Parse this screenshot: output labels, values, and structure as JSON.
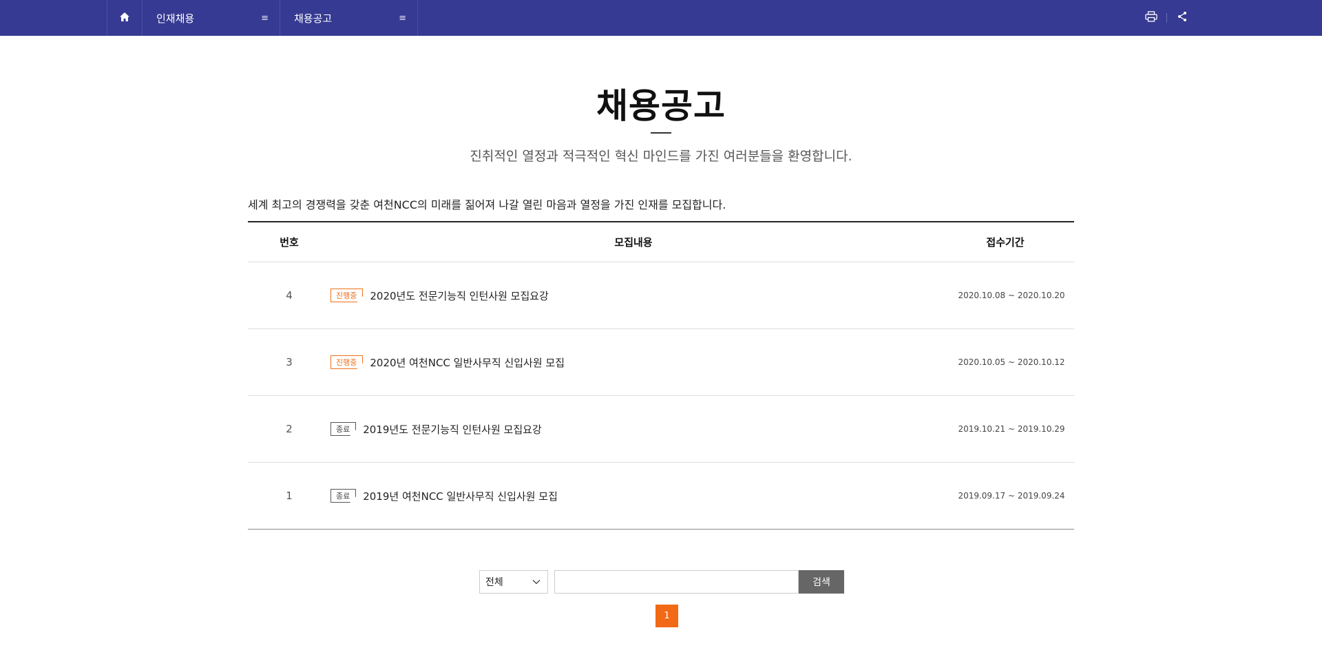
{
  "nav": {
    "home_icon": "home-icon",
    "menu1_label": "인재채용",
    "menu2_label": "채용공고",
    "menu_glyph": "≡",
    "print_icon": "print-icon",
    "share_icon": "share-icon"
  },
  "header": {
    "title": "채용공고",
    "subtitle": "진취적인 열정과 적극적인 혁신 마인드를 가진 여러분들을 환영합니다.",
    "intro": "세계 최고의 경쟁력을 갖춘 여천NCC의 미래를 짊어져 나갈 열린 마음과 열정을 가진 인재를 모집합니다."
  },
  "table": {
    "headers": {
      "no": "번호",
      "title": "모집내용",
      "period": "접수기간"
    },
    "rows": [
      {
        "no": "4",
        "status": "진행중",
        "title": "2020년도 전문기능직 인턴사원 모집요강",
        "period": "2020.10.08 ~ 2020.10.20"
      },
      {
        "no": "3",
        "status": "진행중",
        "title": "2020년 여천NCC 일반사무직 신입사원 모집",
        "period": "2020.10.05 ~ 2020.10.12"
      },
      {
        "no": "2",
        "status": "종료",
        "title": "2019년도 전문기능직 인턴사원 모집요강",
        "period": "2019.10.21 ~ 2019.10.29"
      },
      {
        "no": "1",
        "status": "종료",
        "title": "2019년 여천NCC 일반사무직 신입사원 모집",
        "period": "2019.09.17 ~ 2019.09.24"
      }
    ]
  },
  "search": {
    "select_value": "전체",
    "input_value": "",
    "button_label": "검색"
  },
  "pagination": {
    "current": "1"
  },
  "colors": {
    "nav_bg": "#363a92",
    "accent_orange": "#f26a15",
    "tag_open": "#f0701a",
    "tag_closed": "#555555",
    "search_button": "#666666"
  }
}
